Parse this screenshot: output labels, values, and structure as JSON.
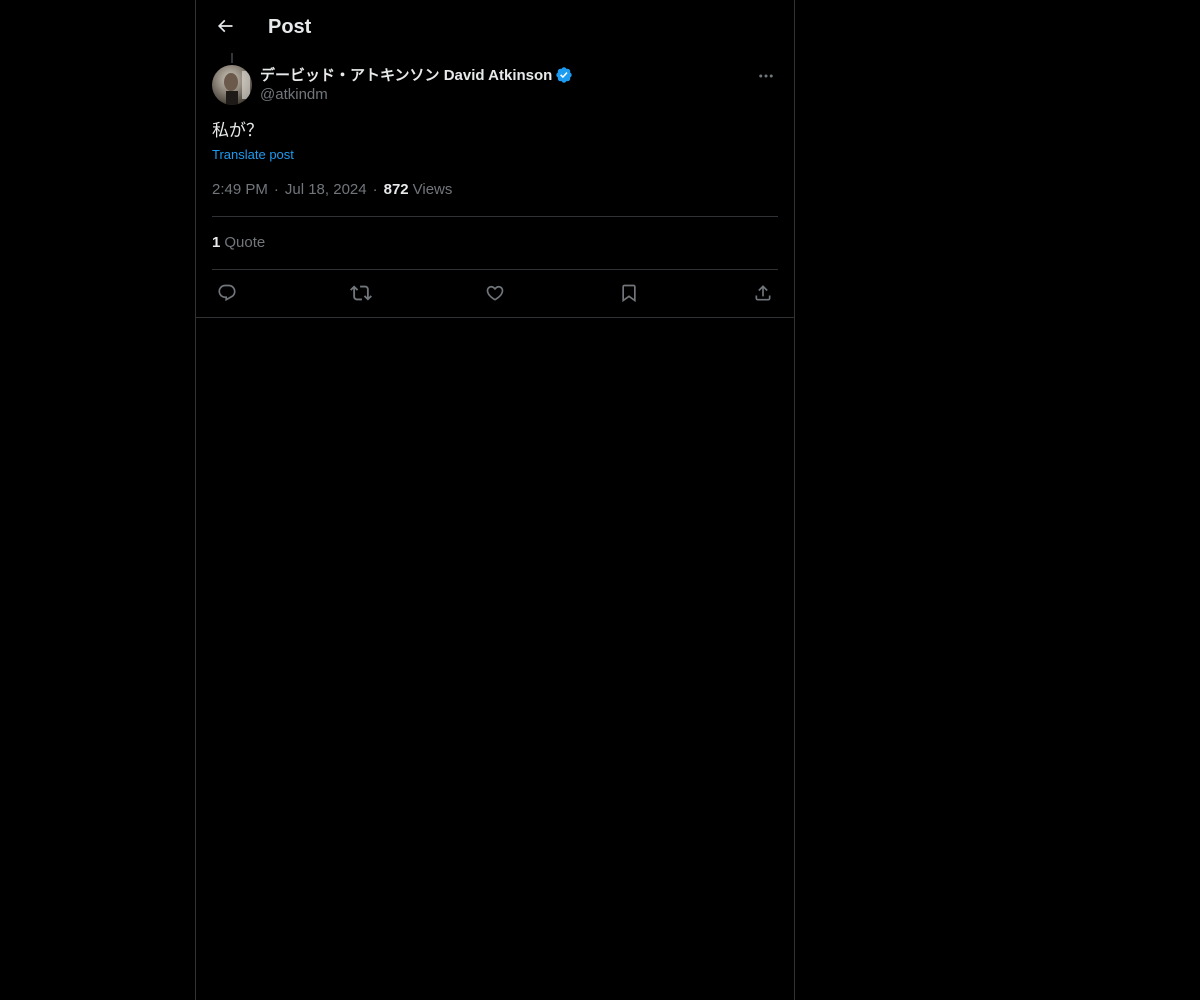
{
  "header": {
    "title": "Post",
    "back_icon": "arrow-left-icon"
  },
  "tweet": {
    "author": {
      "display_name": "デービッド・アトキンソン David Atkinson",
      "handle": "@atkindm",
      "verified": true
    },
    "text": "私が？",
    "translate_label": "Translate post",
    "time": "2:49 PM",
    "separator": "·",
    "date": "Jul 18, 2024",
    "views_count": "872",
    "views_label": "Views",
    "quote_count": "1",
    "quote_label": "Quote",
    "actions": [
      {
        "icon": "reply-icon"
      },
      {
        "icon": "retweet-icon"
      },
      {
        "icon": "like-icon"
      },
      {
        "icon": "bookmark-icon"
      },
      {
        "icon": "share-icon"
      }
    ]
  },
  "colors": {
    "background": "#000000",
    "text_primary": "#e7e9ea",
    "text_secondary": "#71767b",
    "accent": "#1d9bf0",
    "border": "#2f3336"
  }
}
